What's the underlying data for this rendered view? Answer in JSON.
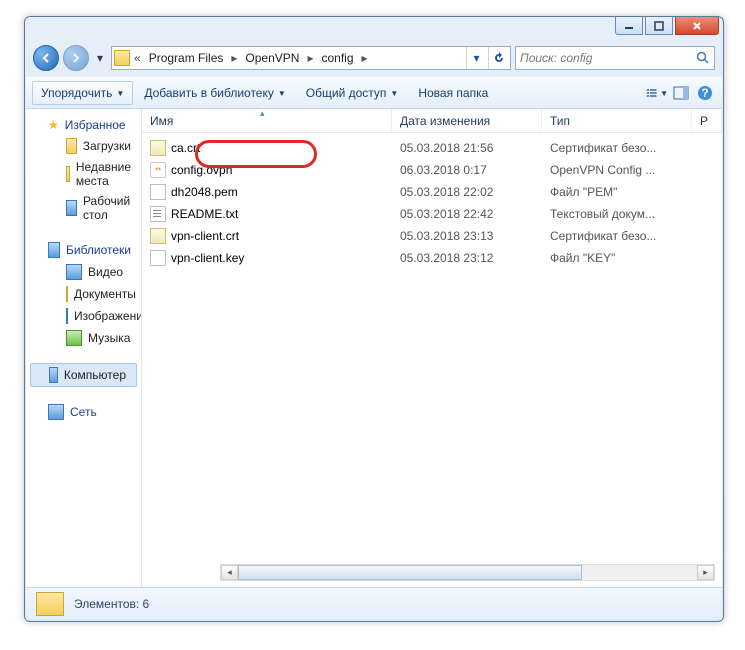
{
  "breadcrumb": {
    "sep1": "«",
    "p1": "Program Files",
    "p2": "OpenVPN",
    "p3": "config"
  },
  "search": {
    "placeholder": "Поиск: config"
  },
  "toolbar": {
    "organize": "Упорядочить",
    "addlib": "Добавить в библиотеку",
    "share": "Общий доступ",
    "newfolder": "Новая папка"
  },
  "columns": {
    "name": "Имя",
    "date": "Дата изменения",
    "type": "Тип",
    "size": "Р"
  },
  "nav": {
    "favorites": "Избранное",
    "downloads": "Загрузки",
    "recent": "Недавние места",
    "desktop": "Рабочий стол",
    "libraries": "Библиотеки",
    "video": "Видео",
    "documents": "Документы",
    "pictures": "Изображения",
    "music": "Музыка",
    "computer": "Компьютер",
    "network": "Сеть"
  },
  "files": {
    "r0": {
      "name": "ca.crt",
      "date": "05.03.2018 21:56",
      "type": "Сертификат безо..."
    },
    "r1": {
      "name": "config.ovpn",
      "date": "06.03.2018 0:17",
      "type": "OpenVPN Config ..."
    },
    "r2": {
      "name": "dh2048.pem",
      "date": "05.03.2018 22:02",
      "type": "Файл \"PEM\""
    },
    "r3": {
      "name": "README.txt",
      "date": "05.03.2018 22:42",
      "type": "Текстовый докум..."
    },
    "r4": {
      "name": "vpn-client.crt",
      "date": "05.03.2018 23:13",
      "type": "Сертификат безо..."
    },
    "r5": {
      "name": "vpn-client.key",
      "date": "05.03.2018 23:12",
      "type": "Файл \"KEY\""
    }
  },
  "status": {
    "text": "Элементов: 6"
  }
}
